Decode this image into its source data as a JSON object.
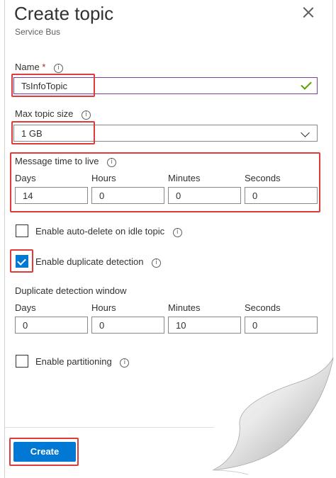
{
  "header": {
    "title": "Create topic",
    "subtitle": "Service Bus"
  },
  "name_field": {
    "label": "Name",
    "required_mark": "*",
    "value": "TsInfoTopic"
  },
  "max_size": {
    "label": "Max topic size",
    "value": "1 GB"
  },
  "ttl": {
    "label": "Message time to live",
    "days_label": "Days",
    "hours_label": "Hours",
    "minutes_label": "Minutes",
    "seconds_label": "Seconds",
    "days": "14",
    "hours": "0",
    "minutes": "0",
    "seconds": "0"
  },
  "auto_delete": {
    "label": "Enable auto-delete on idle topic",
    "checked": false
  },
  "duplicate": {
    "label": "Enable duplicate detection",
    "checked": true
  },
  "dup_window": {
    "label": "Duplicate detection window",
    "days_label": "Days",
    "hours_label": "Hours",
    "minutes_label": "Minutes",
    "seconds_label": "Seconds",
    "days": "0",
    "hours": "0",
    "minutes": "10",
    "seconds": "0"
  },
  "partitioning": {
    "label": "Enable partitioning",
    "checked": false
  },
  "footer": {
    "create_label": "Create"
  },
  "icons": {
    "info": "i"
  },
  "colors": {
    "accent": "#0078d4",
    "highlight": "#e03b3b",
    "valid": "#57a300"
  }
}
